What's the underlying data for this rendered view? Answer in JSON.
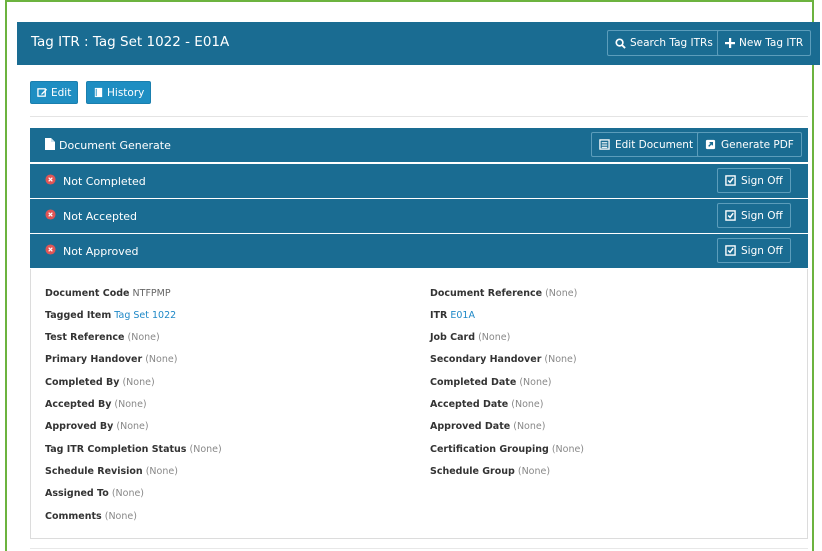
{
  "header": {
    "title": "Tag ITR : Tag Set 1022 - E01A",
    "search_label": "Search Tag ITRs",
    "new_label": "New Tag ITR"
  },
  "toolbar": {
    "edit_label": "Edit",
    "history_label": "History"
  },
  "document_panel": {
    "label": "Document Generate",
    "edit_document_label": "Edit Document",
    "generate_pdf_label": "Generate PDF"
  },
  "status_panels": [
    {
      "label": "Not Completed",
      "button": "Sign Off"
    },
    {
      "label": "Not Accepted",
      "button": "Sign Off"
    },
    {
      "label": "Not Approved",
      "button": "Sign Off"
    }
  ],
  "details": {
    "left": [
      {
        "label": "Document Code",
        "value": "NTFPMP"
      },
      {
        "label": "Tagged Item",
        "value": "Tag Set 1022"
      },
      {
        "label": "Test Reference",
        "value": "(None)"
      },
      {
        "label": "Primary Handover",
        "value": "(None)"
      },
      {
        "label": "Completed By",
        "value": "(None)"
      },
      {
        "label": "Accepted By",
        "value": "(None)"
      },
      {
        "label": "Approved By",
        "value": "(None)"
      },
      {
        "label": "Tag ITR Completion Status",
        "value": "(None)"
      },
      {
        "label": "Schedule Revision",
        "value": "(None)"
      },
      {
        "label": "Assigned To",
        "value": "(None)"
      },
      {
        "label": "Comments",
        "value": "(None)"
      }
    ],
    "right": [
      {
        "label": "Document Reference",
        "value": "(None)"
      },
      {
        "label": "ITR",
        "value": "E01A"
      },
      {
        "label": "Job Card",
        "value": "(None)"
      },
      {
        "label": "Secondary Handover",
        "value": "(None)"
      },
      {
        "label": "Completed Date",
        "value": "(None)"
      },
      {
        "label": "Accepted Date",
        "value": "(None)"
      },
      {
        "label": "Approved Date",
        "value": "(None)"
      },
      {
        "label": "Certification Grouping",
        "value": "(None)"
      },
      {
        "label": "Schedule Group",
        "value": "(None)"
      }
    ]
  },
  "colors": {
    "header": "#1a6c92",
    "button": "#1e8ec2",
    "status_icon": "#e05555",
    "link": "#1e88c7",
    "frame": "#6cb33f"
  }
}
